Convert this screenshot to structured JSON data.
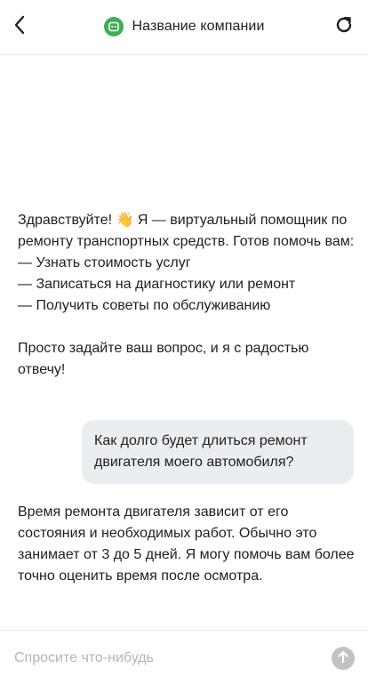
{
  "header": {
    "title": "Название компании",
    "back_icon": "chevron-left-icon",
    "refresh_icon": "refresh-icon",
    "logo_icon": "bot-icon",
    "logo_color": "#3fae55"
  },
  "messages": [
    {
      "role": "bot",
      "text": "Здравствуйте! 👋 Я — виртуальный помощник по ремонту транспортных средств. Готов помочь вам:\n— Узнать стоимость услуг\n— Записаться на диагностику или ремонт\n— Получить советы по обслуживанию\n\nПросто задайте ваш вопрос, и я с радостью отвечу!"
    },
    {
      "role": "user",
      "text": "Как долго будет длиться ремонт двигателя моего автомобиля?"
    },
    {
      "role": "bot",
      "text": "Время ремонта двигателя зависит от его состояния и необходимых работ. Обычно это занимает от 3 до 5 дней. Я могу помочь вам более точно оценить время после осмотра."
    }
  ],
  "composer": {
    "placeholder": "Спросите что-нибудь",
    "value": "",
    "send_icon": "arrow-up-icon"
  },
  "colors": {
    "user_bubble": "#ebeef1",
    "send_button_disabled": "#c2c2c2",
    "divider": "#ebebeb"
  }
}
